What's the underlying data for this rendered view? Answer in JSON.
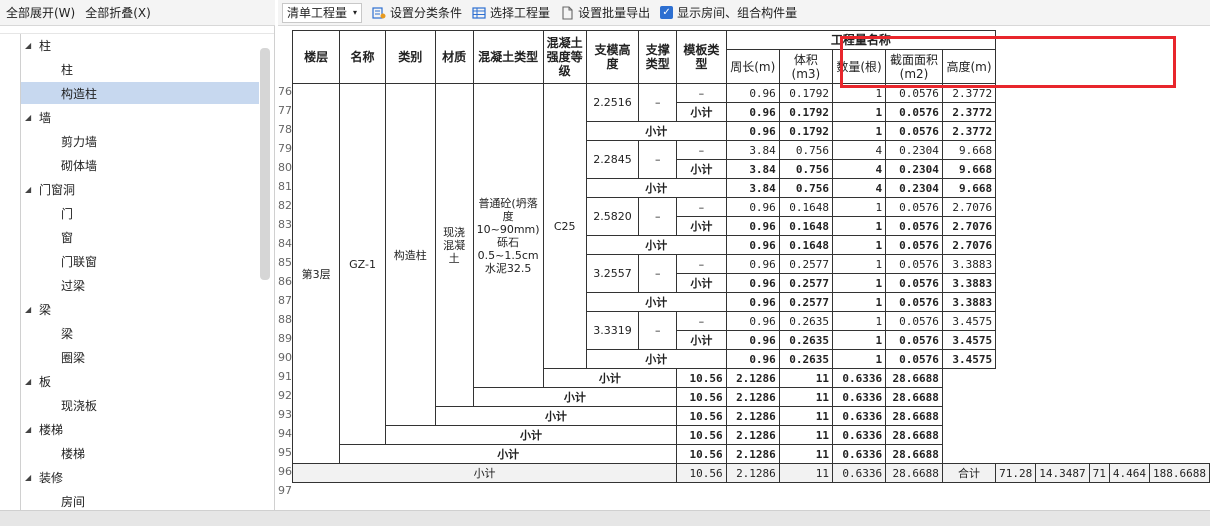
{
  "left_toolbar": {
    "expand_all": "全部展开(W)",
    "collapse_all": "全部折叠(X)"
  },
  "tree": [
    {
      "label": "柱",
      "children": [
        "柱",
        "构造柱"
      ]
    },
    {
      "label": "墙",
      "children": [
        "剪力墙",
        "砌体墙"
      ]
    },
    {
      "label": "门窗洞",
      "children": [
        "门",
        "窗",
        "门联窗",
        "过梁"
      ]
    },
    {
      "label": "梁",
      "children": [
        "梁",
        "圈梁"
      ]
    },
    {
      "label": "板",
      "children": [
        "现浇板"
      ]
    },
    {
      "label": "楼梯",
      "children": [
        "楼梯"
      ]
    },
    {
      "label": "装修",
      "children": [
        "房间"
      ]
    }
  ],
  "selected_tree_item": "构造柱",
  "right_toolbar": {
    "dropdown_value": "清单工程量",
    "set_category": "设置分类条件",
    "select_quantity": "选择工程量",
    "set_batch_export": "设置批量导出",
    "show_rooms": "显示房间、组合构件量"
  },
  "table": {
    "headers": {
      "floor": "楼层",
      "name": "名称",
      "category": "类别",
      "material": "材质",
      "concrete_type": "混凝土类型",
      "concrete_grade": "混凝土强度等级",
      "formwork_height": "支模高度",
      "support_type": "支撑类型",
      "formwork_type": "模板类型",
      "quantity_group": "工程量名称",
      "perimeter": "周长(m)",
      "volume": "体积(m3)",
      "count": "数量(根)",
      "section_area": "截面面积(m2)",
      "height": "高度(m)"
    },
    "row_numbers": [
      "76",
      "77",
      "78",
      "79",
      "80",
      "81",
      "82",
      "83",
      "84",
      "85",
      "86",
      "87",
      "88",
      "89",
      "90",
      "91",
      "92",
      "93",
      "94",
      "95",
      "96",
      "97"
    ],
    "floor": "第3层",
    "name": "GZ-1",
    "category": "构造柱",
    "material": "现浇混凝土",
    "concrete_type": "普通砼(坍落度10~90mm) 砾石0.5~1.5cm 水泥32.5",
    "concrete_grade": "C25",
    "dash": "–",
    "subtotal_label": "小计",
    "total_label": "合计",
    "groups": [
      {
        "height": "2.2516",
        "rows": [
          [
            "0.96",
            "0.1792",
            "1",
            "0.0576",
            "2.3772"
          ],
          [
            "0.96",
            "0.1792",
            "1",
            "0.0576",
            "2.3772"
          ],
          [
            "0.96",
            "0.1792",
            "1",
            "0.0576",
            "2.3772"
          ]
        ]
      },
      {
        "height": "2.2845",
        "rows": [
          [
            "3.84",
            "0.756",
            "4",
            "0.2304",
            "9.668"
          ],
          [
            "3.84",
            "0.756",
            "4",
            "0.2304",
            "9.668"
          ],
          [
            "3.84",
            "0.756",
            "4",
            "0.2304",
            "9.668"
          ]
        ]
      },
      {
        "height": "2.5820",
        "rows": [
          [
            "0.96",
            "0.1648",
            "1",
            "0.0576",
            "2.7076"
          ],
          [
            "0.96",
            "0.1648",
            "1",
            "0.0576",
            "2.7076"
          ],
          [
            "0.96",
            "0.1648",
            "1",
            "0.0576",
            "2.7076"
          ]
        ]
      },
      {
        "height": "3.2557",
        "rows": [
          [
            "0.96",
            "0.2577",
            "1",
            "0.0576",
            "3.3883"
          ],
          [
            "0.96",
            "0.2577",
            "1",
            "0.0576",
            "3.3883"
          ],
          [
            "0.96",
            "0.2577",
            "1",
            "0.0576",
            "3.3883"
          ]
        ]
      },
      {
        "height": "3.3319",
        "rows": [
          [
            "0.96",
            "0.2635",
            "1",
            "0.0576",
            "3.4575"
          ],
          [
            "0.96",
            "0.2635",
            "1",
            "0.0576",
            "3.4575"
          ],
          [
            "0.96",
            "0.2635",
            "1",
            "0.0576",
            "3.4575"
          ]
        ]
      }
    ],
    "cascade_subtotals": [
      [
        "10.56",
        "2.1286",
        "11",
        "0.6336",
        "28.6688"
      ],
      [
        "10.56",
        "2.1286",
        "11",
        "0.6336",
        "28.6688"
      ],
      [
        "10.56",
        "2.1286",
        "11",
        "0.6336",
        "28.6688"
      ],
      [
        "10.56",
        "2.1286",
        "11",
        "0.6336",
        "28.6688"
      ],
      [
        "10.56",
        "2.1286",
        "11",
        "0.6336",
        "28.6688"
      ],
      [
        "10.56",
        "2.1286",
        "11",
        "0.6336",
        "28.6688"
      ]
    ],
    "grand_total": [
      "71.28",
      "14.3487",
      "71",
      "4.464",
      "188.6688"
    ]
  }
}
